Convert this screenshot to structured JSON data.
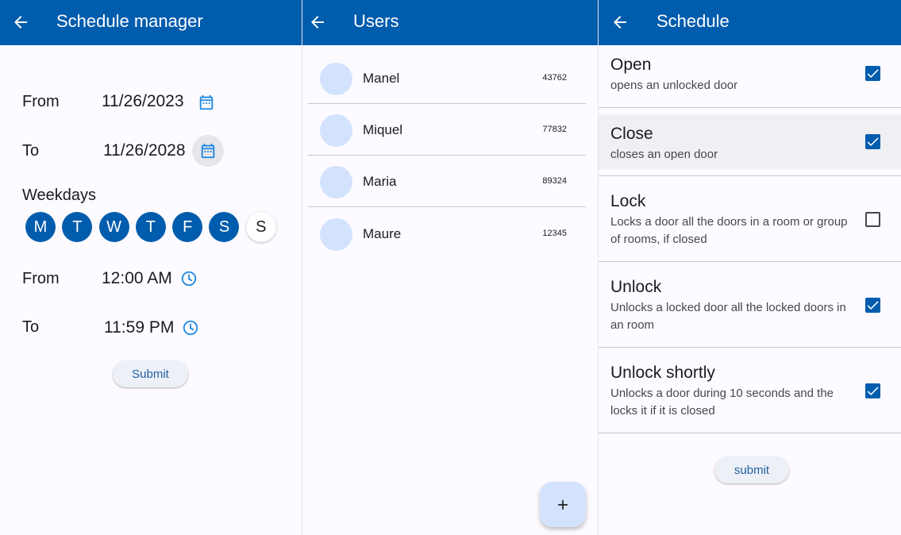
{
  "colors": {
    "appbar": "#005cad",
    "accent": "#005cad",
    "avatar": "#d4e3fd"
  },
  "schedule_manager": {
    "title": "Schedule manager",
    "from_label": "From",
    "from_date": "11/26/2023",
    "to_label": "To",
    "to_date": "11/26/2028",
    "weekdays_label": "Weekdays",
    "weekdays": [
      {
        "letter": "M",
        "selected": true
      },
      {
        "letter": "T",
        "selected": true
      },
      {
        "letter": "W",
        "selected": true
      },
      {
        "letter": "T",
        "selected": true
      },
      {
        "letter": "F",
        "selected": true
      },
      {
        "letter": "S",
        "selected": true
      },
      {
        "letter": "S",
        "selected": false
      }
    ],
    "time_from_label": "From",
    "time_from": "12:00 AM",
    "time_to_label": "To",
    "time_to": "11:59 PM",
    "submit_label": "Submit"
  },
  "users": {
    "title": "Users",
    "list": [
      {
        "name": "Manel",
        "code": "43762"
      },
      {
        "name": "Miquel",
        "code": "77832"
      },
      {
        "name": "Maria",
        "code": "89324"
      },
      {
        "name": "Maure",
        "code": "12345"
      }
    ],
    "fab_label": "+"
  },
  "schedule": {
    "title": "Schedule",
    "actions": [
      {
        "title": "Open",
        "description": "opens an unlocked door",
        "checked": true
      },
      {
        "title": "Close",
        "description": "closes an open door",
        "checked": true
      },
      {
        "title": "Lock",
        "description": "Locks a door all the doors in a room or group of rooms, if closed",
        "checked": false
      },
      {
        "title": "Unlock",
        "description": "Unlocks a locked door all the locked doors in an room",
        "checked": true
      },
      {
        "title": "Unlock shortly",
        "description": "Unlocks a door during 10 seconds and the locks it if it is closed",
        "checked": true
      }
    ],
    "submit_label": "submit"
  }
}
